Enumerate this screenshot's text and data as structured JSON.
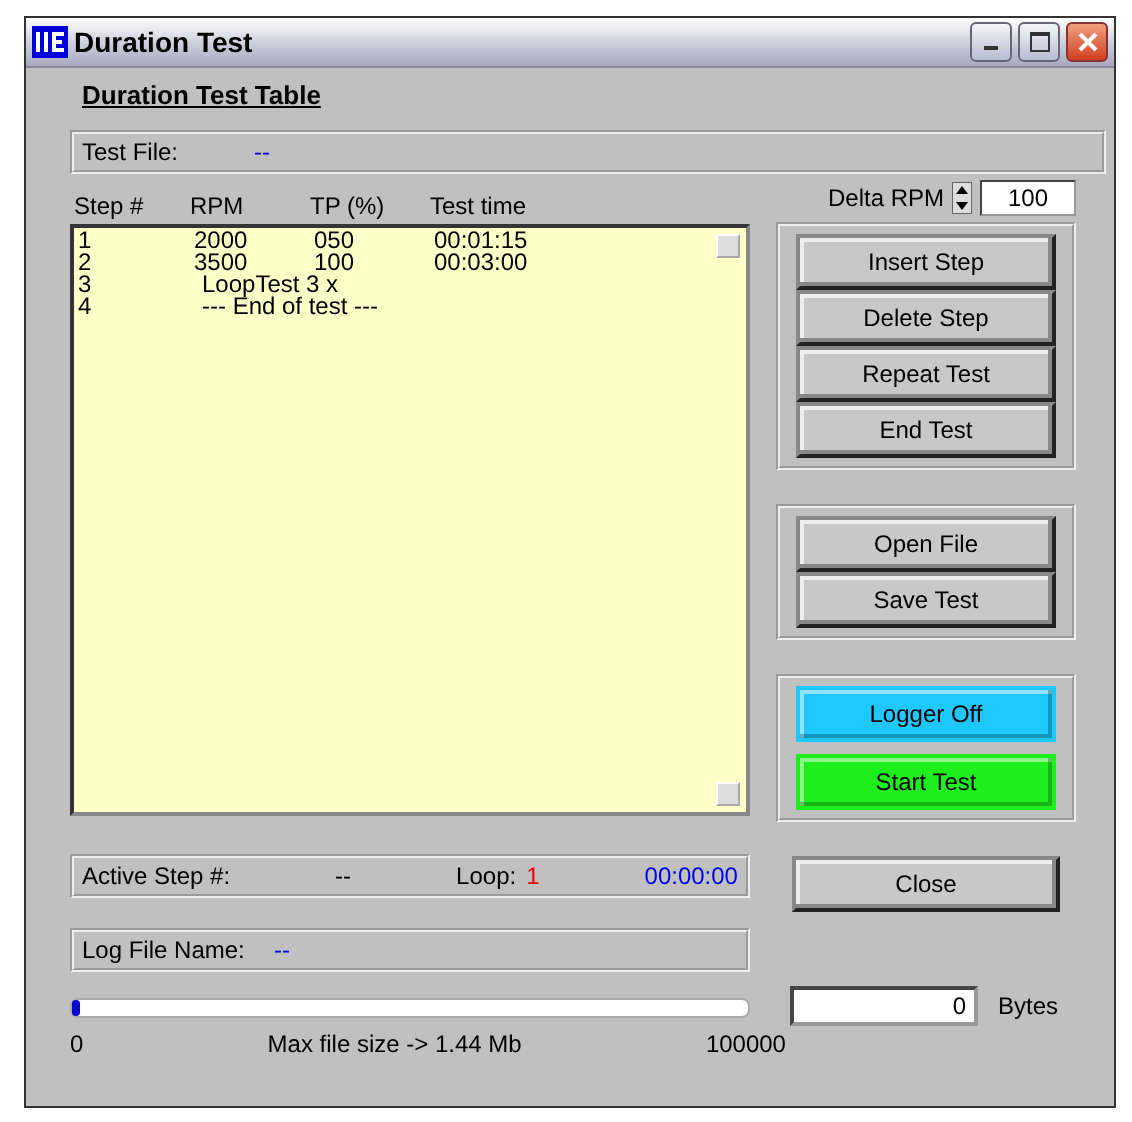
{
  "window": {
    "title": "Duration Test"
  },
  "heading": "Duration Test Table",
  "test_file": {
    "label": "Test File:",
    "value": "--"
  },
  "steps": {
    "columns": [
      "Step #",
      "RPM",
      "TP (%)",
      "Test time"
    ],
    "rows": [
      {
        "kind": "step",
        "cells": [
          "1",
          "2000",
          "050",
          "00:01:15"
        ]
      },
      {
        "kind": "step",
        "cells": [
          "2",
          "3500",
          "100",
          "00:03:00"
        ]
      },
      {
        "kind": "note",
        "cells": [
          "3",
          "LoopTest 3 x"
        ]
      },
      {
        "kind": "note",
        "cells": [
          "4",
          "--- End of test ---"
        ]
      }
    ]
  },
  "delta_rpm": {
    "label": "Delta RPM",
    "value": "100"
  },
  "button_groups": [
    [
      {
        "label": "Insert Step"
      },
      {
        "label": "Delete Step"
      },
      {
        "label": "Repeat Test"
      },
      {
        "label": "End Test"
      }
    ],
    [
      {
        "label": "Open File"
      },
      {
        "label": "Save Test"
      }
    ],
    [
      {
        "label": "Logger Off",
        "color": "#1ec8ff"
      },
      {
        "label": "Start Test",
        "color": "#1ef01e"
      }
    ]
  ],
  "close_button": "Close",
  "active_step": {
    "label": "Active Step #:",
    "value": "--",
    "loop_label": "Loop:",
    "loop_value": "1",
    "time": "00:00:00"
  },
  "log_file": {
    "label": "Log File Name:",
    "value": "--"
  },
  "file_size": {
    "level": 0.01,
    "min": "0",
    "caption": "Max file size -> 1.44 Mb",
    "max": "100000"
  },
  "bytes": {
    "value": "0",
    "unit": "Bytes"
  }
}
